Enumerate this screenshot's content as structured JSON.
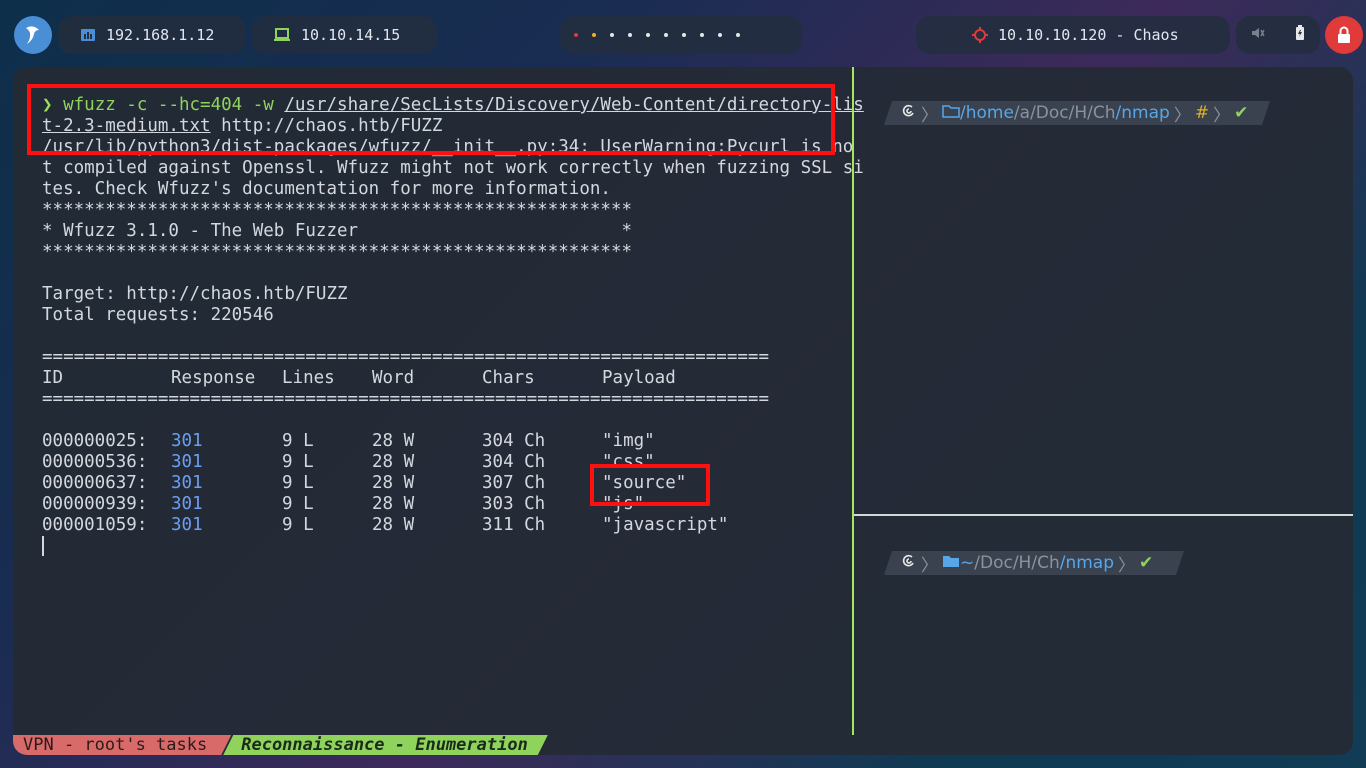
{
  "topbar": {
    "ip_local": "192.168.1.12",
    "ip_vpn": "10.10.14.15",
    "target": "10.10.10.120 - Chaos",
    "colors": {
      "accent_blue": "#4a8fd6",
      "vpn_green": "#8fd35c",
      "target_red": "#e03a3a"
    }
  },
  "left_pane": {
    "prompt_symbol": "❯",
    "cmd_part1": "wfuzz -c --hc=404 -w ",
    "cmd_path1": "/usr/share/SecLists/Discovery/Web-Content/directory-lis",
    "cmd_path2": "t-2.3-medium.txt",
    "cmd_url": " http://chaos.htb/FUZZ",
    "warn1": "/usr/lib/python3/dist-packages/wfuzz/__init__.py:34: UserWarning:Pycurl is no",
    "warn2": "t compiled against Openssl. Wfuzz might not work correctly when fuzzing SSL si",
    "warn3": "tes. Check Wfuzz's documentation for more information.",
    "banner_stars": "********************************************************",
    "banner_title": "* Wfuzz 3.1.0 - The Web Fuzzer                         *",
    "target_line": "Target: http://chaos.htb/FUZZ",
    "total_line": "Total requests: 220546",
    "rule": "=====================================================================",
    "headers": {
      "id": "ID",
      "response": "Response",
      "lines": "Lines",
      "word": "Word",
      "chars": "Chars",
      "payload": "Payload"
    },
    "rows": [
      {
        "id": "000000025:",
        "response": "301",
        "lines": "9 L",
        "word": "28 W",
        "chars": "304 Ch",
        "payload": "\"img\""
      },
      {
        "id": "000000536:",
        "response": "301",
        "lines": "9 L",
        "word": "28 W",
        "chars": "304 Ch",
        "payload": "\"css\""
      },
      {
        "id": "000000637:",
        "response": "301",
        "lines": "9 L",
        "word": "28 W",
        "chars": "307 Ch",
        "payload": "\"source\""
      },
      {
        "id": "000000939:",
        "response": "301",
        "lines": "9 L",
        "word": "28 W",
        "chars": "303 Ch",
        "payload": "\"js\""
      },
      {
        "id": "000001059:",
        "response": "301",
        "lines": "9 L",
        "word": "28 W",
        "chars": "311 Ch",
        "payload": "\"javascript\""
      }
    ]
  },
  "right_top": {
    "path": [
      "/home",
      "/a",
      "/Doc",
      "/H",
      "/Ch",
      "/nmap"
    ],
    "hash": "#",
    "check": "✔"
  },
  "right_bottom": {
    "path": [
      "~",
      "/Doc",
      "/H",
      "/Ch",
      "/nmap"
    ],
    "check": "✔"
  },
  "statusbar": {
    "left": "VPN - root's tasks",
    "right": "Reconnaissance - Enumeration"
  }
}
